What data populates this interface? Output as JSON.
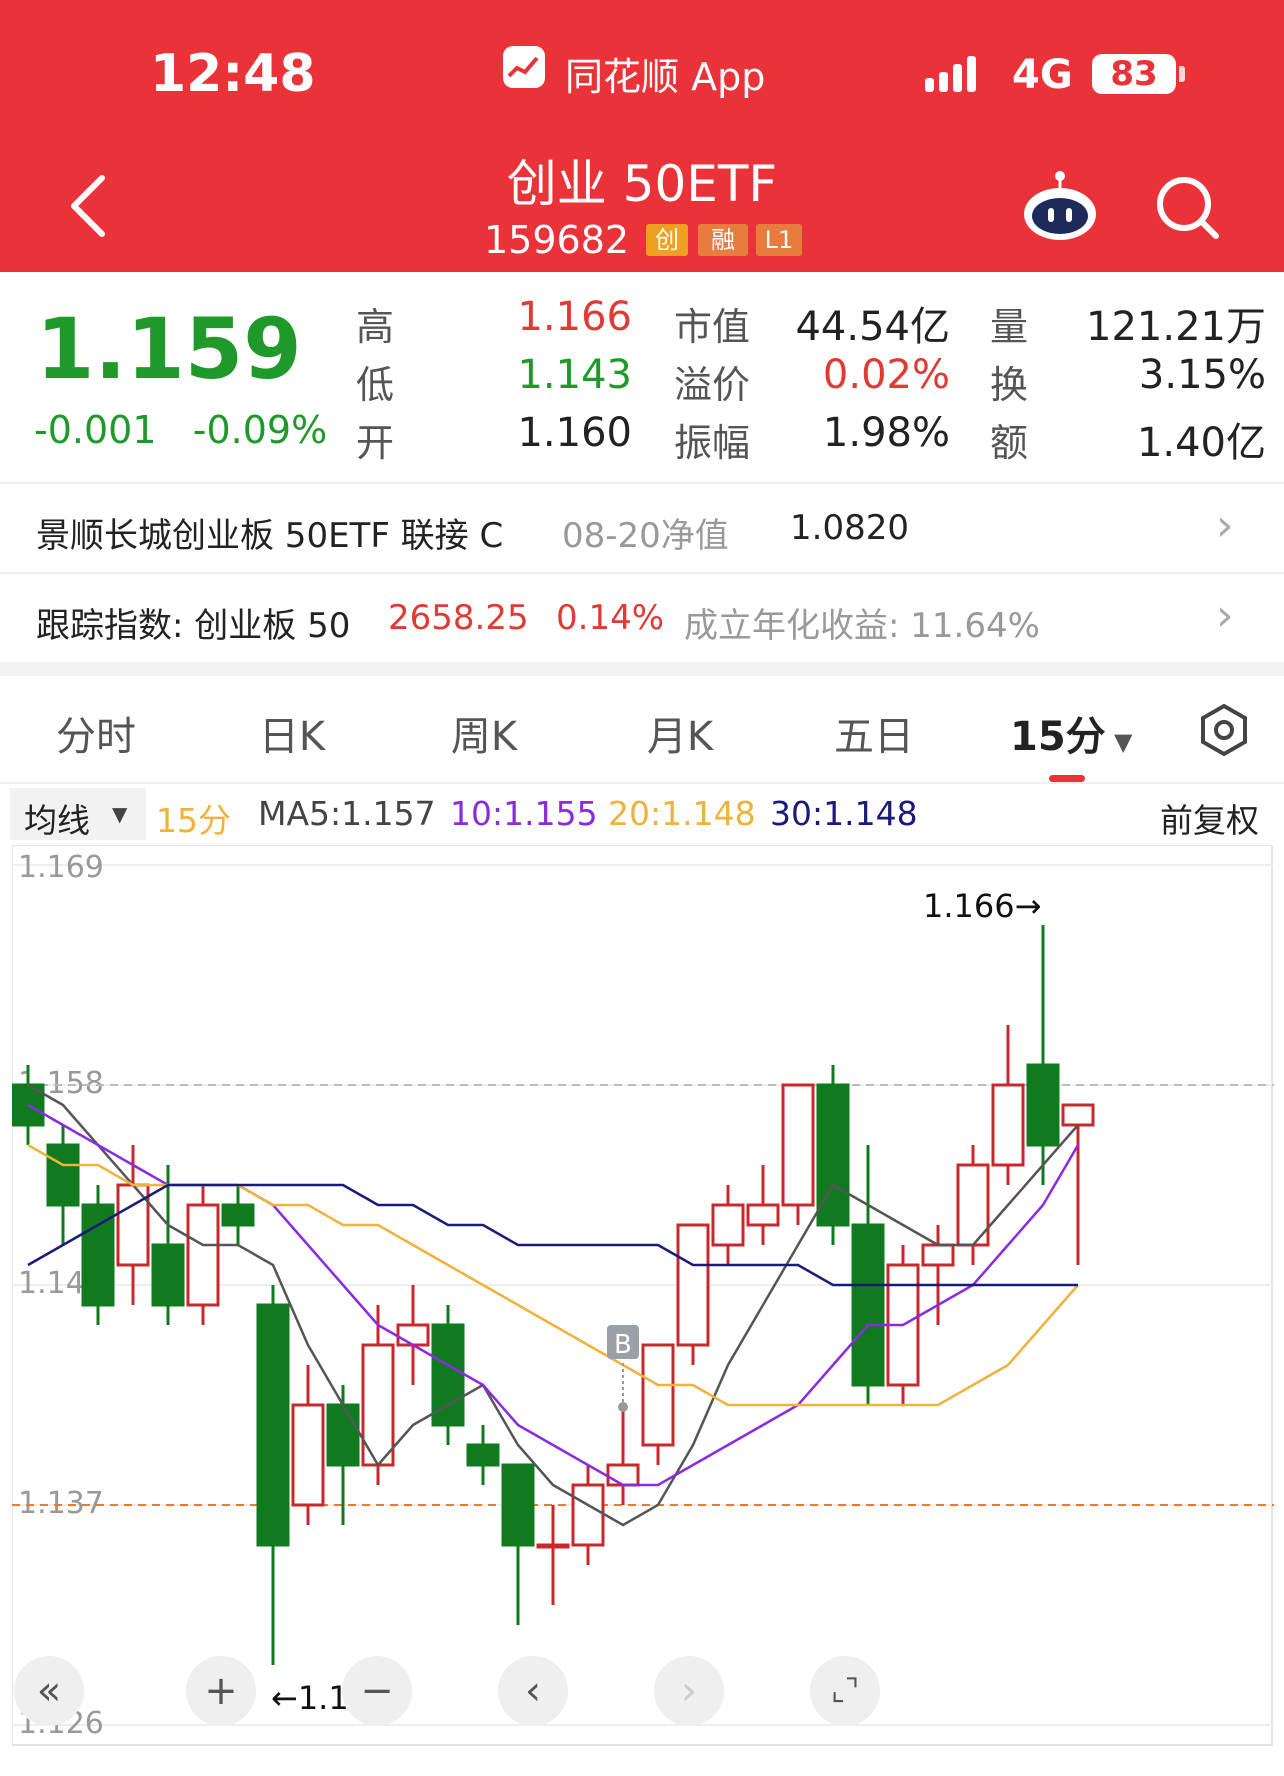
{
  "status_bar": {
    "time": "12:48",
    "app": "同花顺 App",
    "network": "4G",
    "battery": "83"
  },
  "header": {
    "title": "创业 50ETF",
    "code": "159682",
    "tags": [
      "创",
      "融",
      "L1"
    ]
  },
  "quote": {
    "price": "1.159",
    "change": "-0.001",
    "change_pct": "-0.09%",
    "fields": [
      {
        "label": "高",
        "value": "1.166",
        "color": "#e03a34"
      },
      {
        "label": "低",
        "value": "1.143",
        "color": "#1f9a2a"
      },
      {
        "label": "开",
        "value": "1.160",
        "color": "#222222"
      }
    ],
    "fields2": [
      {
        "label": "市值",
        "value": "44.54亿",
        "color": "#222222"
      },
      {
        "label": "溢价",
        "value": "0.02%",
        "color": "#e03a34"
      },
      {
        "label": "振幅",
        "value": "1.98%",
        "color": "#222222"
      }
    ],
    "fields3": [
      {
        "label": "量",
        "value": "121.21万"
      },
      {
        "label": "换",
        "value": "3.15%"
      },
      {
        "label": "额",
        "value": "1.40亿"
      }
    ]
  },
  "fund_row": {
    "name": "景顺长城创业板 50ETF 联接 C",
    "date_label": "08-20净值",
    "nav": "1.0820"
  },
  "index_row": {
    "label": "跟踪指数: 创业板 50",
    "value": "2658.25",
    "pct": "0.14%",
    "annual": "成立年化收益: 11.64%"
  },
  "tabs": [
    "分时",
    "日K",
    "周K",
    "月K",
    "五日",
    "15分"
  ],
  "chart_legend": {
    "selector": "均线",
    "period": "15分",
    "ma5": "MA5:1.157",
    "ma10": "10:1.155",
    "ma20": "20:1.148",
    "ma30": "30:1.148",
    "adjust": "前复权"
  },
  "chart_data": {
    "type": "candlestick",
    "y_ticks": [
      "1.169",
      "1.158",
      "1.148",
      "1.137",
      "1.126"
    ],
    "ylim": [
      1.126,
      1.169
    ],
    "high_label": "1.166→",
    "low_label": "←1.129",
    "marker_label": "B",
    "candles": [
      {
        "o": 1.158,
        "c": 1.156,
        "h": 1.159,
        "l": 1.155
      },
      {
        "o": 1.155,
        "c": 1.152,
        "h": 1.156,
        "l": 1.15
      },
      {
        "o": 1.152,
        "c": 1.147,
        "h": 1.153,
        "l": 1.146
      },
      {
        "o": 1.149,
        "c": 1.153,
        "h": 1.155,
        "l": 1.147
      },
      {
        "o": 1.15,
        "c": 1.147,
        "h": 1.154,
        "l": 1.146
      },
      {
        "o": 1.147,
        "c": 1.152,
        "h": 1.153,
        "l": 1.146
      },
      {
        "o": 1.152,
        "c": 1.151,
        "h": 1.153,
        "l": 1.15
      },
      {
        "o": 1.147,
        "c": 1.135,
        "h": 1.148,
        "l": 1.129
      },
      {
        "o": 1.137,
        "c": 1.142,
        "h": 1.144,
        "l": 1.136
      },
      {
        "o": 1.142,
        "c": 1.139,
        "h": 1.143,
        "l": 1.136
      },
      {
        "o": 1.139,
        "c": 1.145,
        "h": 1.147,
        "l": 1.138
      },
      {
        "o": 1.145,
        "c": 1.146,
        "h": 1.148,
        "l": 1.143
      },
      {
        "o": 1.146,
        "c": 1.141,
        "h": 1.147,
        "l": 1.14
      },
      {
        "o": 1.14,
        "c": 1.139,
        "h": 1.141,
        "l": 1.138
      },
      {
        "o": 1.139,
        "c": 1.135,
        "h": 1.139,
        "l": 1.131
      },
      {
        "o": 1.135,
        "c": 1.135,
        "h": 1.137,
        "l": 1.132
      },
      {
        "o": 1.135,
        "c": 1.138,
        "h": 1.139,
        "l": 1.134
      },
      {
        "o": 1.138,
        "c": 1.139,
        "h": 1.142,
        "l": 1.137
      },
      {
        "o": 1.14,
        "c": 1.145,
        "h": 1.145,
        "l": 1.139
      },
      {
        "o": 1.145,
        "c": 1.151,
        "h": 1.151,
        "l": 1.144
      },
      {
        "o": 1.15,
        "c": 1.152,
        "h": 1.153,
        "l": 1.149
      },
      {
        "o": 1.151,
        "c": 1.152,
        "h": 1.154,
        "l": 1.15
      },
      {
        "o": 1.152,
        "c": 1.158,
        "h": 1.158,
        "l": 1.151
      },
      {
        "o": 1.158,
        "c": 1.151,
        "h": 1.159,
        "l": 1.15
      },
      {
        "o": 1.151,
        "c": 1.143,
        "h": 1.155,
        "l": 1.142
      },
      {
        "o": 1.143,
        "c": 1.149,
        "h": 1.15,
        "l": 1.142
      },
      {
        "o": 1.149,
        "c": 1.15,
        "h": 1.151,
        "l": 1.146
      },
      {
        "o": 1.15,
        "c": 1.154,
        "h": 1.155,
        "l": 1.149
      },
      {
        "o": 1.154,
        "c": 1.158,
        "h": 1.161,
        "l": 1.153
      },
      {
        "o": 1.159,
        "c": 1.155,
        "h": 1.166,
        "l": 1.153
      },
      {
        "o": 1.156,
        "c": 1.157,
        "h": 1.157,
        "l": 1.149
      }
    ],
    "ma5": [
      1.158,
      1.157,
      1.155,
      1.153,
      1.151,
      1.15,
      1.15,
      1.149,
      1.145,
      1.142,
      1.139,
      1.141,
      1.142,
      1.143,
      1.14,
      1.138,
      1.137,
      1.136,
      1.137,
      1.14,
      1.144,
      1.147,
      1.15,
      1.153,
      1.152,
      1.151,
      1.15,
      1.15,
      1.152,
      1.154,
      1.156
    ],
    "ma10": [
      1.157,
      1.156,
      1.155,
      1.154,
      1.153,
      1.153,
      1.153,
      1.152,
      1.15,
      1.148,
      1.146,
      1.145,
      1.144,
      1.143,
      1.141,
      1.14,
      1.139,
      1.138,
      1.138,
      1.139,
      1.14,
      1.141,
      1.142,
      1.144,
      1.146,
      1.146,
      1.147,
      1.148,
      1.15,
      1.152,
      1.155
    ],
    "ma20": [
      1.155,
      1.154,
      1.154,
      1.153,
      1.153,
      1.153,
      1.153,
      1.152,
      1.152,
      1.151,
      1.151,
      1.15,
      1.149,
      1.148,
      1.147,
      1.146,
      1.145,
      1.144,
      1.143,
      1.143,
      1.142,
      1.142,
      1.142,
      1.142,
      1.142,
      1.142,
      1.142,
      1.143,
      1.144,
      1.146,
      1.148
    ],
    "ma30": [
      1.149,
      1.15,
      1.151,
      1.152,
      1.153,
      1.153,
      1.153,
      1.153,
      1.153,
      1.153,
      1.152,
      1.152,
      1.151,
      1.151,
      1.15,
      1.15,
      1.15,
      1.15,
      1.15,
      1.149,
      1.149,
      1.149,
      1.149,
      1.148,
      1.148,
      1.148,
      1.148,
      1.148,
      1.148,
      1.148,
      1.148
    ],
    "ref_line_price": 1.158,
    "ref_line_low": 1.137,
    "colors": {
      "up": "#c8282c",
      "down": "#0f7a1e",
      "ma5": "#555555",
      "ma10": "#8a2be2",
      "ma20": "#f0b23a",
      "ma30": "#1a1a7a"
    }
  },
  "controls": [
    "«",
    "+",
    "−",
    "‹",
    "›",
    "⌞⌝"
  ]
}
